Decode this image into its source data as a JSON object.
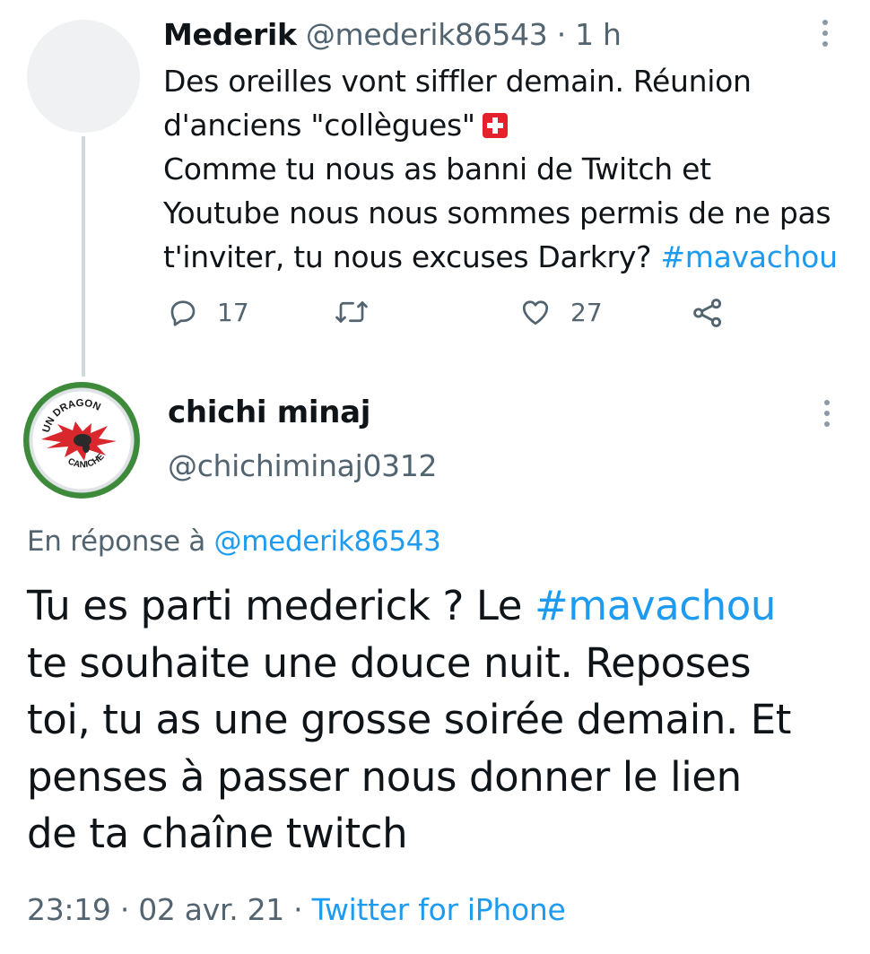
{
  "tweet1": {
    "author_name": "Mederik",
    "author_handle": "@mederik86543",
    "separator": "·",
    "time": "1 h",
    "lines": [
      "Des oreilles vont siffler demain. Réunion",
      "d'anciens \"collègues\"",
      "Comme tu nous as banni de Twitch et",
      "Youtube nous nous sommes permis de ne pas",
      "t'inviter, tu nous excuses Darkry? "
    ],
    "hashtag": "#mavachou",
    "flag_emoji": "swiss-flag-icon",
    "actions": {
      "reply_count": "17",
      "like_count": "27"
    }
  },
  "tweet2": {
    "author_name": "chichi minaj",
    "author_handle": "@chichiminaj0312",
    "avatar": {
      "text_top": "UN DRAGON",
      "text_bottom": "CANICHE",
      "icon": "dragon-icon"
    },
    "reply_to_prefix": "En réponse à ",
    "reply_to_handle": "@mederik86543",
    "body_lines": [
      "Tu es parti mederick ? Le ",
      "te souhaite une douce nuit. Reposes",
      "toi, tu as une grosse soirée demain. Et",
      "penses à passer nous donner le lien",
      "de ta chaîne twitch"
    ],
    "hashtag": "#mavachou",
    "time": "23:19",
    "date": "02 avr. 21",
    "separator": "·",
    "source": "Twitter for iPhone"
  },
  "colors": {
    "accent": "#1d9bf0",
    "muted": "#536471",
    "text": "#0f1419",
    "thread_line": "#cfd9de",
    "swiss_red": "#e5212b"
  }
}
